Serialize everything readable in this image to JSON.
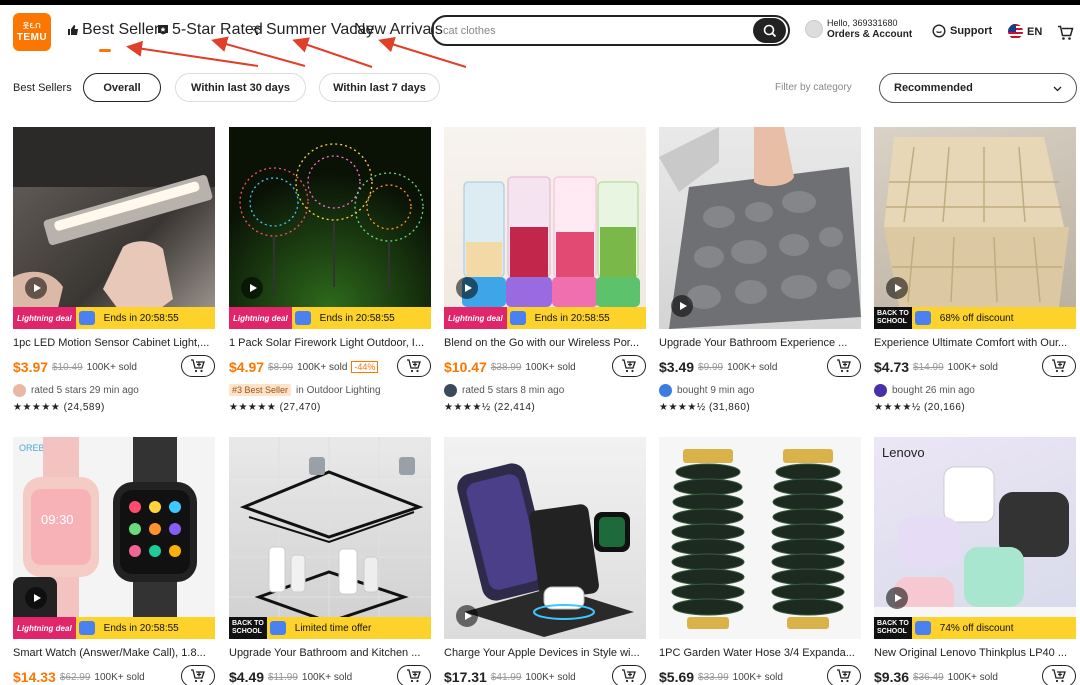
{
  "header": {
    "logo_line1": "웃ᘍᙁ",
    "logo_line2": "TEMU",
    "nav": [
      "Best Sellers",
      "5-Star Rated",
      "Summer Vacay",
      "New Arrivals"
    ],
    "search_value": "cat clothes",
    "greeting": "Hello, 369331680",
    "account": "Orders & Account",
    "support": "Support",
    "language": "EN"
  },
  "filters": {
    "label": "Best Sellers",
    "pills": [
      "Overall",
      "Within last 30 days",
      "Within last 7 days"
    ],
    "category": "Filter by category",
    "sort": "Recommended"
  },
  "colors": {
    "brand": "#fb7701",
    "deal_bar": "#fdd32b",
    "lightning": "#e1256b"
  },
  "products": [
    {
      "title": "1pc LED Motion Sensor Cabinet Light,...",
      "price": "$3.97",
      "old": "$10.49",
      "sold": "100K+ sold",
      "deal": "Ends in 20:58:55",
      "deal_type": "lightning",
      "social": "rated 5 stars 29 min ago",
      "stars": "★★★★★ (24,589)",
      "price_orange": true
    },
    {
      "title": "1 Pack Solar Firework Light Outdoor, I...",
      "price": "$4.97",
      "old": "$8.99",
      "sold": "100K+ sold",
      "discount": "-44%",
      "deal": "Ends in 20:58:55",
      "deal_type": "lightning",
      "best_badge": "#3 Best Seller",
      "social": "in Outdoor Lighting",
      "stars": "★★★★★ (27,470)",
      "price_orange": true
    },
    {
      "title": "Blend on the Go with our Wireless Por...",
      "price": "$10.47",
      "old": "$38.99",
      "sold": "100K+ sold",
      "deal": "Ends in 20:58:55",
      "deal_type": "lightning",
      "social": "rated 5 stars 8 min ago",
      "stars": "★★★★½ (22,414)",
      "price_orange": true
    },
    {
      "title": "Upgrade Your Bathroom Experience ...",
      "price": "$3.49",
      "old": "$9.99",
      "sold": "100K+ sold",
      "social": "bought 9 min ago",
      "stars": "★★★★½ (31,860)",
      "price_orange": false
    },
    {
      "title": "Experience Ultimate Comfort with Our...",
      "price": "$4.73",
      "old": "$14.99",
      "sold": "100K+ sold",
      "deal": "68% off discount",
      "deal_type": "school",
      "social": "bought 26 min ago",
      "stars": "★★★★½ (20,166)",
      "price_orange": false
    },
    {
      "title": "Smart Watch (Answer/Make Call), 1.8...",
      "price": "$14.33",
      "old": "$62.99",
      "sold": "100K+ sold",
      "deal": "Ends in 20:58:55",
      "deal_type": "lightning",
      "price_orange": true
    },
    {
      "title": "Upgrade Your Bathroom and Kitchen ...",
      "price": "$4.49",
      "old": "$11.99",
      "sold": "100K+ sold",
      "deal": "Limited time offer",
      "deal_type": "school",
      "price_orange": false
    },
    {
      "title": "Charge Your Apple Devices in Style wi...",
      "price": "$17.31",
      "old": "$41.99",
      "sold": "100K+ sold",
      "price_orange": false
    },
    {
      "title": "1PC Garden Water Hose 3/4 Expanda...",
      "price": "$5.69",
      "old": "$33.99",
      "sold": "100K+ sold",
      "price_orange": false
    },
    {
      "title": "New Original Lenovo Thinkplus LP40 ...",
      "price": "$9.36",
      "old": "$36.49",
      "sold": "100K+ sold",
      "deal": "74% off discount",
      "deal_type": "school",
      "price_orange": false
    }
  ],
  "deal_labels": {
    "lightning": "Lightning deal",
    "school_top": "BACK TO",
    "school_bottom": "SCHOOL"
  },
  "image_texts": {
    "watch_brand": "OREBOE",
    "watch_time": "09:30",
    "lenovo": "Lenovo"
  }
}
